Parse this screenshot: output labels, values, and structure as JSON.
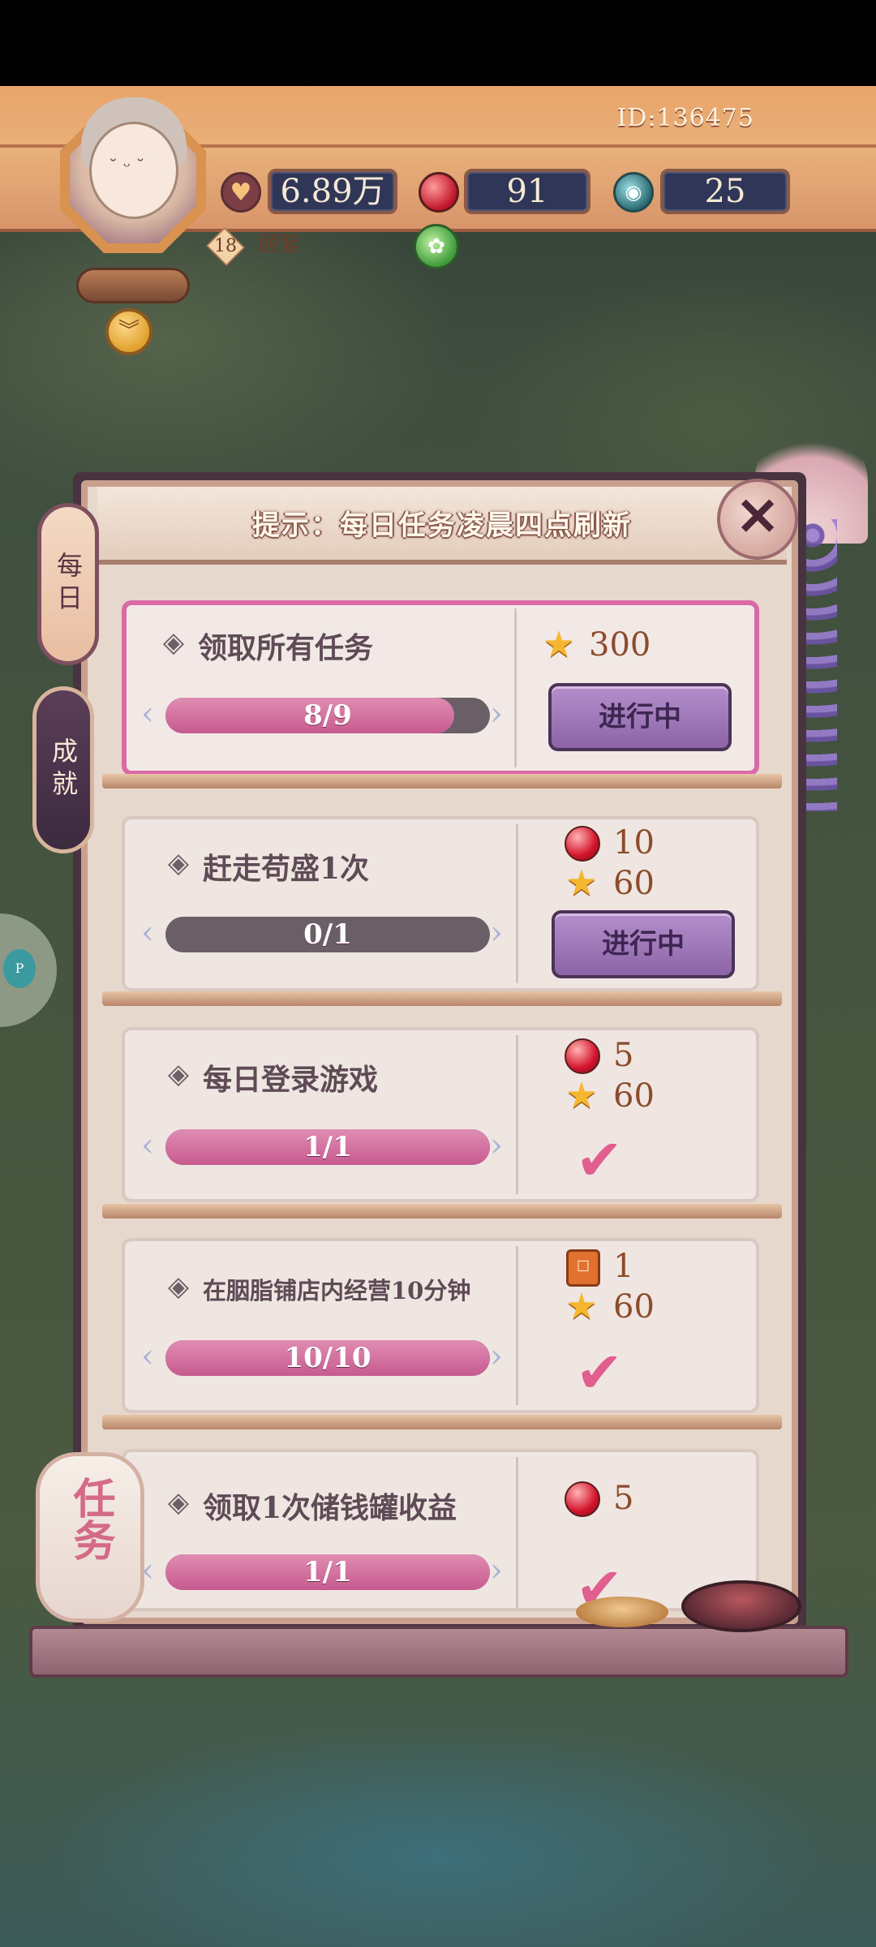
{
  "header": {
    "player_id": "ID:136475",
    "level": "18",
    "player_name": "顾絮",
    "resources": [
      {
        "icon": "heart-coin-icon",
        "value": "6.89万"
      },
      {
        "icon": "red-gem-icon",
        "value": "91"
      },
      {
        "icon": "jade-coin-icon",
        "value": "25"
      }
    ]
  },
  "side_tabs": [
    {
      "label": "每日",
      "selected": true
    },
    {
      "label": "成就",
      "selected": false
    }
  ],
  "panel": {
    "hint": "提示：每日任务凌晨四点刷新"
  },
  "tasks": [
    {
      "title": "领取所有任务",
      "progress_text": "8/9",
      "progress_fraction": 0.889,
      "rewards": [
        {
          "icon": "star-icon",
          "value": "300"
        }
      ],
      "status": "in_progress",
      "status_label": "进行中",
      "highlighted": true
    },
    {
      "title": "赶走苟盛1次",
      "progress_text": "0/1",
      "progress_fraction": 0,
      "rewards": [
        {
          "icon": "red-gem-icon",
          "value": "10"
        },
        {
          "icon": "star-icon",
          "value": "60"
        }
      ],
      "status": "in_progress",
      "status_label": "进行中",
      "highlighted": false
    },
    {
      "title": "每日登录游戏",
      "progress_text": "1/1",
      "progress_fraction": 1,
      "rewards": [
        {
          "icon": "red-gem-icon",
          "value": "5"
        },
        {
          "icon": "star-icon",
          "value": "60"
        }
      ],
      "status": "done",
      "status_label": "",
      "highlighted": false
    },
    {
      "title": "在胭脂铺店内经营10分钟",
      "progress_text": "10/10",
      "progress_fraction": 1,
      "rewards": [
        {
          "icon": "ticket-icon",
          "value": "1"
        },
        {
          "icon": "star-icon",
          "value": "60"
        }
      ],
      "status": "done",
      "status_label": "",
      "highlighted": false
    },
    {
      "title": "领取1次储钱罐收益",
      "progress_text": "1/1",
      "progress_fraction": 1,
      "rewards": [
        {
          "icon": "red-gem-icon",
          "value": "5"
        }
      ],
      "status": "done",
      "status_label": "",
      "highlighted": false
    }
  ],
  "bottom": {
    "lantern_label": "任务"
  },
  "colors": {
    "accent_pink": "#c75a8f",
    "button_purple": "#8c64a7",
    "header_orange": "#e9a469",
    "panel_dark": "#4a3340"
  }
}
